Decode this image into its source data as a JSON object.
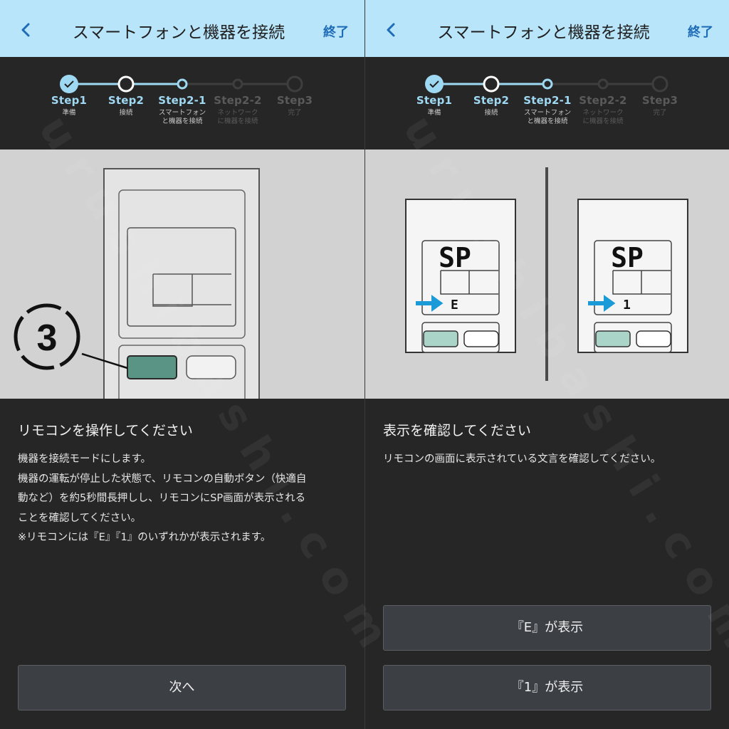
{
  "left": {
    "header": {
      "title": "スマートフォンと機器を接続",
      "exit_label": "終了"
    },
    "steps": [
      {
        "label": "Step1",
        "sub": "準備",
        "state": "done"
      },
      {
        "label": "Step2",
        "sub": "接続",
        "state": "current"
      },
      {
        "label": "Step2-1",
        "sub": "スマートフォン\nと機器を接続",
        "state": "active"
      },
      {
        "label": "Step2-2",
        "sub": "ネットワーク\nに機器を接続",
        "state": "inactive"
      },
      {
        "label": "Step3",
        "sub": "完了",
        "state": "inactive"
      }
    ],
    "callout_number": "3",
    "heading": "リモコンを操作してください",
    "body_lines": [
      "機器を接続モードにします。",
      "機器の運転が停止した状態で、リモコンの自動ボタン（快適自",
      "動など）を約5秒間長押しし、リモコンにSP画面が表示される",
      "ことを確認してください。",
      "※リモコンには『E』『1』のいずれかが表示されます。"
    ],
    "next_button": "次へ"
  },
  "right": {
    "header": {
      "title": "スマートフォンと機器を接続",
      "exit_label": "終了"
    },
    "steps": [
      {
        "label": "Step1",
        "sub": "準備",
        "state": "done"
      },
      {
        "label": "Step2",
        "sub": "接続",
        "state": "current"
      },
      {
        "label": "Step2-1",
        "sub": "スマートフォン\nと機器を接続",
        "state": "active"
      },
      {
        "label": "Step2-2",
        "sub": "ネットワーク\nに機器を接続",
        "state": "inactive"
      },
      {
        "label": "Step3",
        "sub": "完了",
        "state": "inactive"
      }
    ],
    "remote_a": {
      "display_top": "SP",
      "display_code": "E"
    },
    "remote_b": {
      "display_top": "SP",
      "display_code": "1"
    },
    "heading": "表示を確認してください",
    "body_lines": [
      "リモコンの画面に表示されている文言を確認してください。"
    ],
    "option_e_button": "『E』が表示",
    "option_1_button": "『1』が表示"
  },
  "watermark": "urushibashi.com",
  "colors": {
    "header_bg": "#b8e5f9",
    "accent_blue": "#1e6bb8",
    "step_active": "#9fd8f2",
    "arrow_blue": "#1a9ad6",
    "auto_button_green": "#5a9484",
    "screen_button_green": "#a9d4c7"
  }
}
